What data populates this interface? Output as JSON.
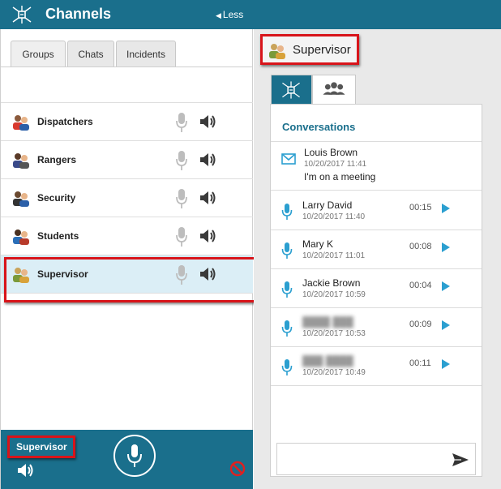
{
  "header": {
    "title": "Channels",
    "less_label": "Less"
  },
  "left_tabs": [
    {
      "label": "Groups"
    },
    {
      "label": "Chats"
    },
    {
      "label": "Incidents"
    }
  ],
  "channels": [
    {
      "label": "Dispatchers"
    },
    {
      "label": "Rangers"
    },
    {
      "label": "Security"
    },
    {
      "label": "Students"
    },
    {
      "label": "Supervisor"
    }
  ],
  "bottom": {
    "active_label": "Supervisor"
  },
  "right": {
    "title": "Supervisor",
    "conversations_heading": "Conversations",
    "message": {
      "name": "Louis Brown",
      "timestamp": "10/20/2017 11:41",
      "body": "I'm on a meeting"
    },
    "voice_rows": [
      {
        "name": "Larry David",
        "timestamp": "10/20/2017 11:40",
        "duration": "00:15"
      },
      {
        "name": "Mary K",
        "timestamp": "10/20/2017 11:01",
        "duration": "00:08"
      },
      {
        "name": "Jackie Brown",
        "timestamp": "10/20/2017 10:59",
        "duration": "00:04"
      },
      {
        "name": "████ ███",
        "timestamp": "10/20/2017 10:53",
        "duration": "00:09"
      },
      {
        "name": "███ ████",
        "timestamp": "10/20/2017 10:49",
        "duration": "00:11"
      }
    ],
    "compose_placeholder": ""
  },
  "colors": {
    "brand": "#1a6f8c",
    "highlight_border": "#d8141a",
    "accent_blue": "#2b9fd0",
    "selected_row": "#dbeef6"
  }
}
